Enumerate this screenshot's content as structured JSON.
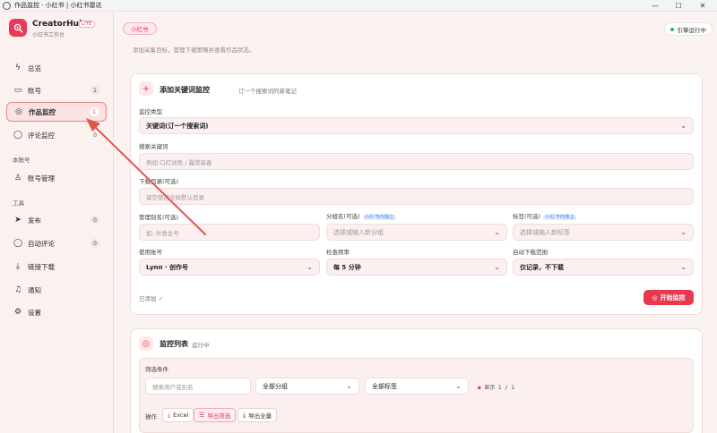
{
  "window": {
    "title": "作品监控 · 小红书 | 小红书雷达",
    "minimize": "—",
    "maximize": "☐",
    "close": "✕"
  },
  "brand": {
    "name": "CreatorHub",
    "badge": "LITE",
    "subtitle": "小红书工作台"
  },
  "sidebar": {
    "items": [
      {
        "label": "总览",
        "icon": "bolt-icon",
        "glyph": "ϟ",
        "count": ""
      },
      {
        "label": "账号",
        "icon": "id-card-icon",
        "glyph": "▭",
        "count": "1"
      },
      {
        "label": "作品监控",
        "icon": "target-icon",
        "glyph": "◎",
        "count": "1"
      },
      {
        "label": "评论监控",
        "icon": "comment-icon",
        "glyph": "◯",
        "count": "0"
      }
    ],
    "section_account": "本账号",
    "account_items": [
      {
        "label": "账号管理",
        "icon": "user-icon",
        "glyph": "♙"
      }
    ],
    "section_tools": "工具",
    "tool_items": [
      {
        "label": "发布",
        "icon": "send-icon",
        "glyph": "➤",
        "count": "0"
      },
      {
        "label": "自动评论",
        "icon": "chat-icon",
        "glyph": "◯",
        "count": "0"
      },
      {
        "label": "链接下载",
        "icon": "download-icon",
        "glyph": "⤓",
        "count": ""
      },
      {
        "label": "通知",
        "icon": "bell-icon",
        "glyph": "♫",
        "count": ""
      },
      {
        "label": "设置",
        "icon": "gear-icon",
        "glyph": "⚙",
        "count": ""
      }
    ]
  },
  "header": {
    "platform_tab": "小红书",
    "engine_status": "引擎运行中",
    "cut_text": "添加采集目标，管理下载策略并查看作品状态。"
  },
  "add_card": {
    "title": "添加关键词监控",
    "subtitle": "订一个搜索词的新笔记",
    "monitor_type_label": "监控类型",
    "monitor_type_value": "关键词(订一个搜索词)",
    "keyword_label": "搜索关键词",
    "keyword_placeholder": "例如:口红试色 / 露营装备",
    "dir_label": "下载目录(可选)",
    "dir_placeholder": "留空使用全局默认目录",
    "alias_label": "管理别名(可选)",
    "alias_placeholder": "如: 伙食主号",
    "group_label": "分组名(可选)",
    "group_tag": "小红书内独立",
    "group_placeholder": "选择或输入新分组",
    "tags_label": "标签(可选)",
    "tags_tag": "小红书内独立",
    "tags_placeholder": "选择或输入新标签",
    "account_label": "使用账号",
    "account_value": "Lynn · 创作号",
    "freq_label": "检查频率",
    "freq_value": "每 5 分钟",
    "range_label": "自动下载范围",
    "range_value": "仅记录，不下载",
    "added_status": "已添加 ✓",
    "start_button": "开始监控"
  },
  "list_card": {
    "title": "监控列表",
    "subtitle": "运行中",
    "filter_label": "筛选条件",
    "search_placeholder": "搜索用户或别名",
    "group_filter": "全部分组",
    "tag_filter": "全部标签",
    "shown_count": "显示 1 / 1",
    "actions_label": "操作",
    "excel_button": "Excel",
    "export_filtered": "导出筛选",
    "export_all": "导出全量"
  },
  "colors": {
    "accent": "#e8384f",
    "annotation_arrow": "#e0564f",
    "status_ok": "#2fb36a"
  }
}
